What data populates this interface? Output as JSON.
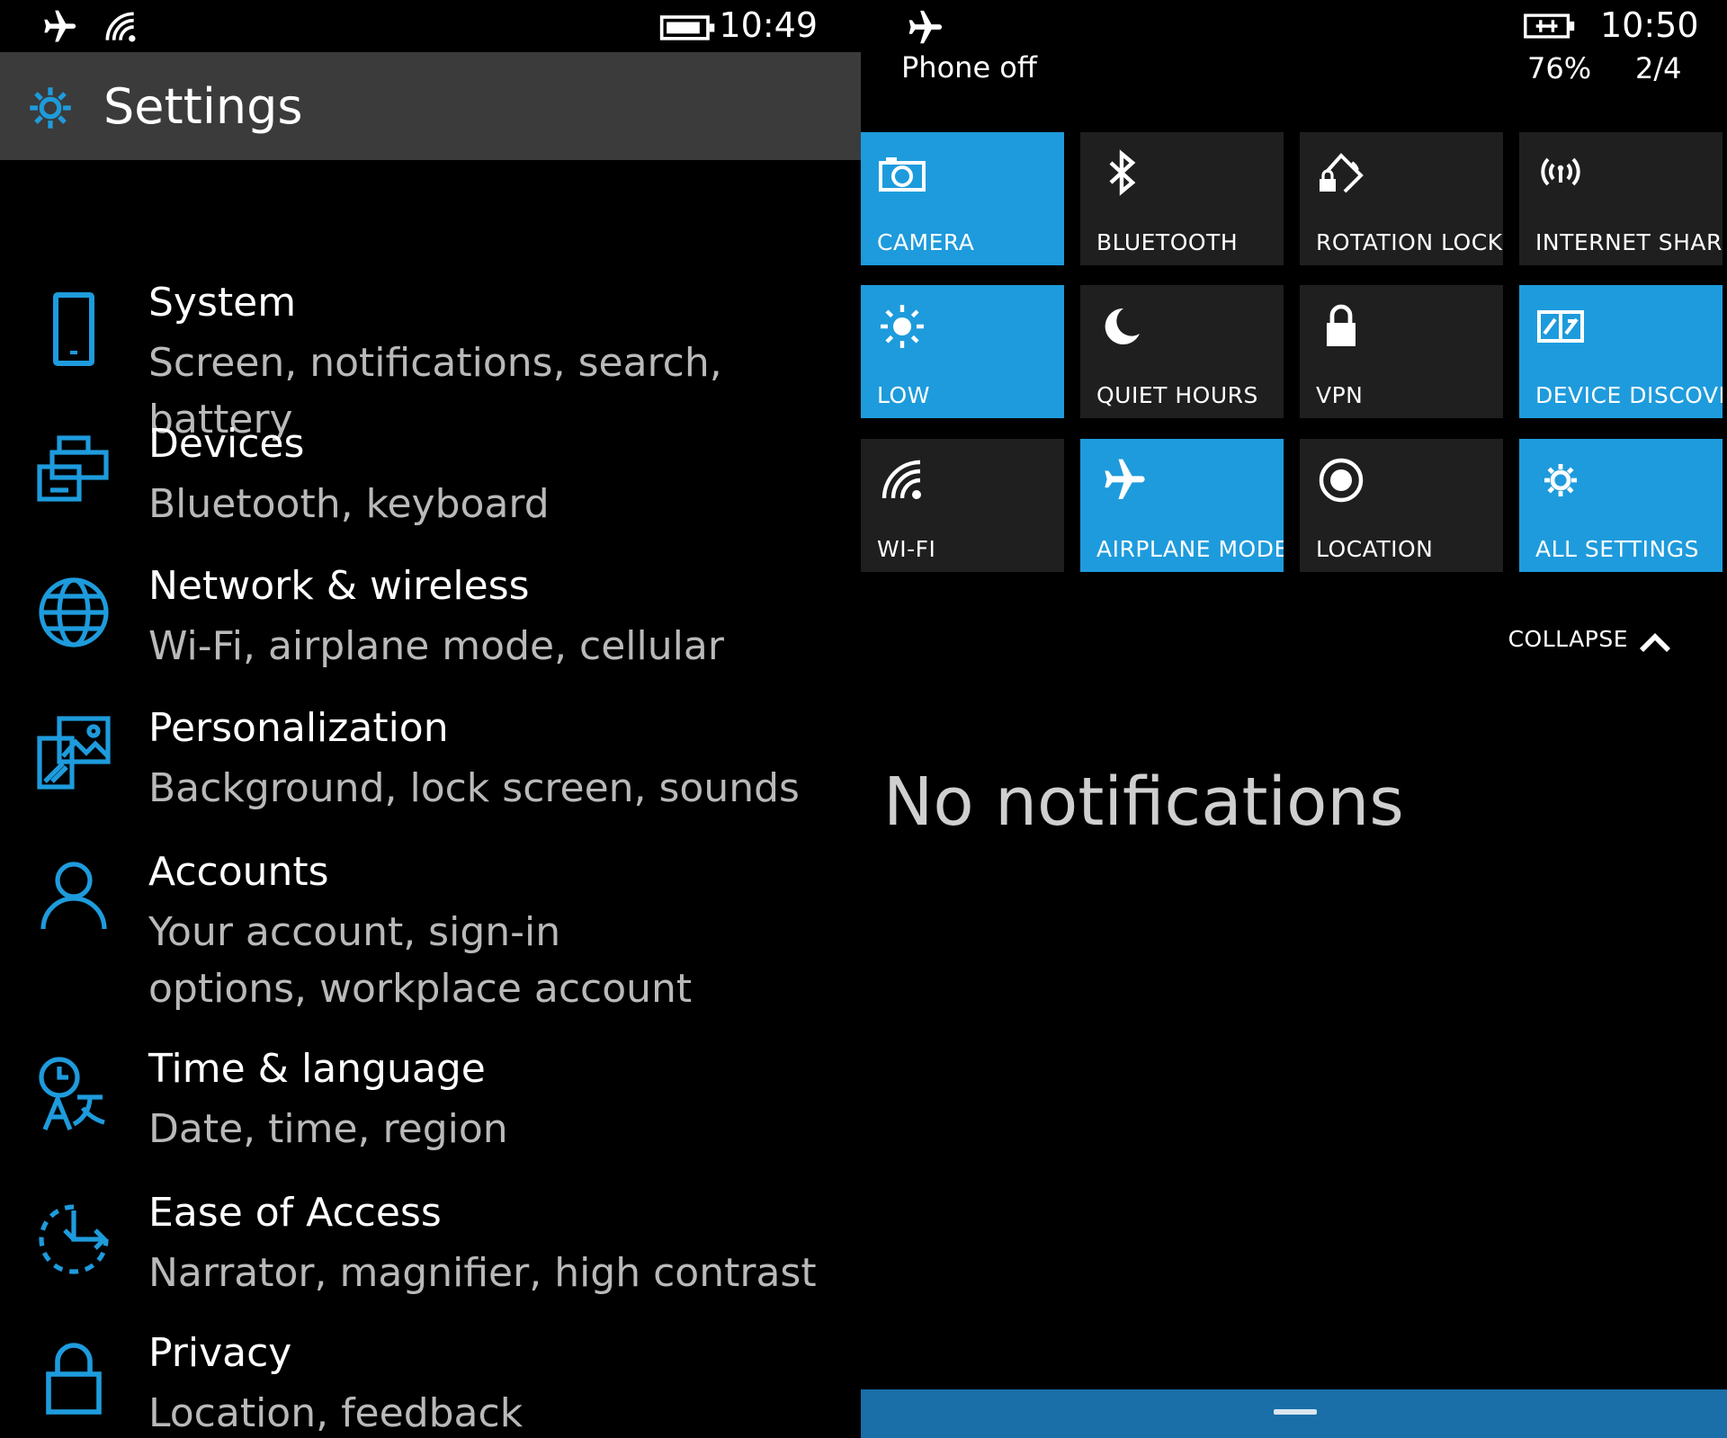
{
  "colors": {
    "accent": "#1e9bdc",
    "header_bg": "#3b3b3b",
    "tile_off": "#1f1f1f",
    "secondary_text": "#b9b9b9",
    "bottom_bar": "#1a6fa8"
  },
  "left": {
    "status": {
      "time": "10:49",
      "icons": [
        "airplane-icon",
        "wifi-icon",
        "battery-icon"
      ]
    },
    "header": {
      "title": "Settings",
      "icon": "gear-icon"
    },
    "items": [
      {
        "name": "System",
        "desc": "Screen, notifications, search, battery",
        "icon": "phone-icon"
      },
      {
        "name": "Devices",
        "desc": "Bluetooth, keyboard",
        "icon": "devices-icon"
      },
      {
        "name": "Network & wireless",
        "desc": "Wi-Fi, airplane mode, cellular",
        "icon": "globe-icon"
      },
      {
        "name": "Personalization",
        "desc": "Background, lock screen, sounds",
        "icon": "personalization-icon"
      },
      {
        "name": "Accounts",
        "desc": "Your account, sign-in options, workplace account",
        "icon": "person-icon"
      },
      {
        "name": "Time & language",
        "desc": "Date, time, region",
        "icon": "time-language-icon"
      },
      {
        "name": "Ease of Access",
        "desc": "Narrator, magnifier, high contrast",
        "icon": "ease-of-access-icon"
      },
      {
        "name": "Privacy",
        "desc": "Location, feedback",
        "icon": "lock-icon"
      }
    ]
  },
  "right": {
    "status": {
      "phone_state": "Phone off",
      "time": "10:50",
      "battery_pct": "76%",
      "page": "2/4"
    },
    "tiles": [
      {
        "label": "CAMERA",
        "on": true,
        "icon": "camera-icon"
      },
      {
        "label": "BLUETOOTH",
        "on": false,
        "icon": "bluetooth-icon"
      },
      {
        "label": "ROTATION LOCK",
        "on": false,
        "icon": "rotation-lock-icon"
      },
      {
        "label": "INTERNET SHARI",
        "on": false,
        "icon": "internet-sharing-icon"
      },
      {
        "label": "LOW",
        "on": true,
        "icon": "brightness-icon"
      },
      {
        "label": "QUIET HOURS",
        "on": false,
        "icon": "moon-icon"
      },
      {
        "label": "VPN",
        "on": false,
        "icon": "vpn-lock-icon"
      },
      {
        "label": "DEVICE DISCOVE",
        "on": true,
        "icon": "device-discovery-icon"
      },
      {
        "label": "WI-FI",
        "on": false,
        "icon": "wifi-icon"
      },
      {
        "label": "AIRPLANE MODE",
        "on": true,
        "icon": "airplane-icon"
      },
      {
        "label": "LOCATION",
        "on": false,
        "icon": "location-icon"
      },
      {
        "label": "ALL SETTINGS",
        "on": true,
        "icon": "gear-icon"
      }
    ],
    "collapse_label": "COLLAPSE",
    "empty_message": "No notifications"
  }
}
